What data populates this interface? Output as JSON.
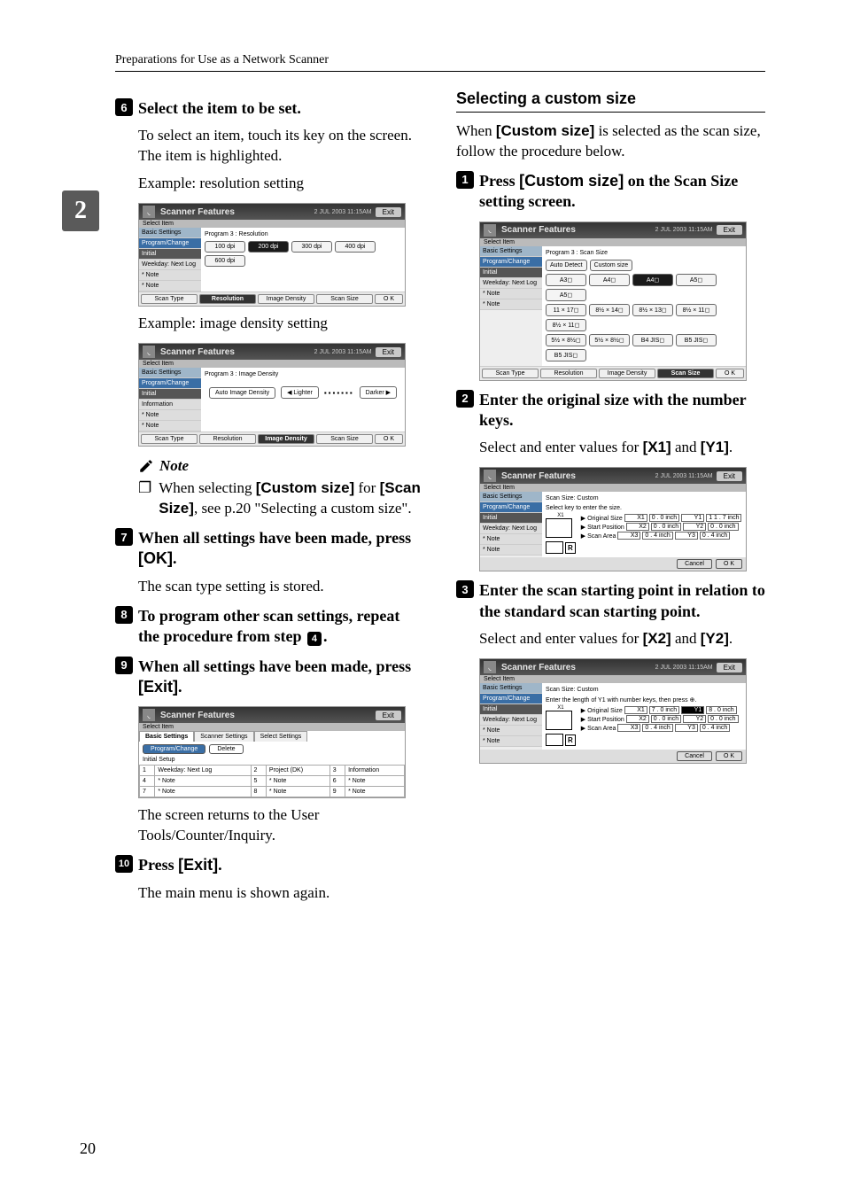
{
  "page": {
    "header": "Preparations for Use as a Network Scanner",
    "number": "20",
    "side_tab": "2"
  },
  "left": {
    "step6": {
      "badge": "6",
      "title": "Select the item to be set.",
      "p1": "To select an item, touch its key on the screen. The item is highlighted.",
      "p2": "Example: resolution setting",
      "p3": "Example: image density setting"
    },
    "note": {
      "heading": "Note",
      "item1_a": "When selecting ",
      "item1_b": "[Custom size]",
      "item1_c": " for ",
      "item1_d": "[Scan Size]",
      "item1_e": ", see p.20 \"Selecting a custom size\"."
    },
    "step7": {
      "badge": "7",
      "t1": "When all settings have been made, press ",
      "t2": "[OK]",
      "t3": ".",
      "p1": "The scan type setting is stored."
    },
    "step8": {
      "badge": "8",
      "t1": "To program other scan settings, repeat the procedure from step ",
      "t2": "4",
      "t3": "."
    },
    "step9": {
      "badge": "9",
      "t1": "When all settings have been made, press ",
      "t2": "[Exit]",
      "t3": ".",
      "p1": "The screen returns to the User Tools/Counter/Inquiry."
    },
    "step10": {
      "badge": "10",
      "t1": "Press ",
      "t2": "[Exit]",
      "t3": ".",
      "p1": "The main menu is shown again."
    }
  },
  "right": {
    "subhead": "Selecting a custom size",
    "intro_a": "When ",
    "intro_b": "[Custom size]",
    "intro_c": " is selected as the scan size, follow the procedure below.",
    "step1": {
      "badge": "1",
      "t1": "Press ",
      "t2": "[Custom size]",
      "t3": " on the Scan Size setting screen."
    },
    "step2": {
      "badge": "2",
      "t1": "Enter the original size with the number keys.",
      "p1_a": "Select and enter values for ",
      "p1_b": "[X1]",
      "p1_c": " and ",
      "p1_d": "[Y1]",
      "p1_e": "."
    },
    "step3": {
      "badge": "3",
      "t1": "Enter the scan starting point in relation to the standard scan starting point.",
      "p1_a": "Select and enter values for ",
      "p1_b": "[X2]",
      "p1_c": " and ",
      "p1_d": "[Y2]",
      "p1_e": "."
    }
  },
  "shots": {
    "common": {
      "title": "Scanner Features",
      "exit": "Exit",
      "date": "2 JUL 2003 11:15AM",
      "select_item": "Select Item",
      "side_basic": "Basic Settings",
      "side_prog": "Program/Change",
      "side_initial": "Initial",
      "side_week": "Weekday: Next Log",
      "side_info": "Information",
      "side_note": "* Note",
      "tabs": {
        "scan_type": "Scan Type",
        "resolution": "Resolution",
        "image_density": "Image Density",
        "scan_size": "Scan Size",
        "ok": "O K"
      }
    },
    "resolution": {
      "crumb": "Program 3 : Resolution",
      "opts": [
        "100 dpi",
        "200 dpi",
        "300 dpi",
        "400 dpi",
        "600 dpi"
      ],
      "sel": "200 dpi"
    },
    "density": {
      "crumb": "Program 3 : Image Density",
      "auto": "Auto Image Density",
      "lighter": "◀ Lighter",
      "darker": "Darker ▶"
    },
    "exitlist": {
      "tabs": [
        "Basic Settings",
        "Scanner Settings",
        "Select Settings"
      ],
      "btns": [
        "Program/Change",
        "Delete"
      ],
      "initial": "Initial Setup",
      "rows": [
        [
          "1",
          "Weekday: Next Log",
          "2",
          "Project (DK)",
          "3",
          "Information"
        ],
        [
          "4",
          "* Note",
          "5",
          "* Note",
          "6",
          "* Note"
        ],
        [
          "7",
          "* Note",
          "8",
          "* Note",
          "9",
          "* Note"
        ]
      ]
    },
    "scansize": {
      "crumb": "Program 3 : Scan Size",
      "auto": "Auto Detect",
      "custom": "Custom size",
      "row1": [
        "A3◻",
        "A4◻",
        "A4◻",
        "A5◻",
        "A5◻"
      ],
      "row2": [
        "11 × 17◻",
        "8½ × 14◻",
        "8½ × 13◻",
        "8½ × 11◻",
        "8½ × 11◻"
      ],
      "row3": [
        "5½ × 8½◻",
        "5½ × 8½◻",
        "B4 JIS◻",
        "B5 JIS◻",
        "B5 JIS◻"
      ]
    },
    "custom1": {
      "crumb": "Scan Size: Custom",
      "hint": "Select key to enter the size.",
      "labels": {
        "orig": "▶ Original Size",
        "start": "▶ Start Position",
        "area": "▶ Scan Area",
        "r": "R",
        "x1": "X1",
        "x2": "X2",
        "x3": "X3",
        "y1": "Y1",
        "y2": "Y2",
        "y3": "Y3"
      },
      "vals": {
        "x1": "0 .  0 inch",
        "y1": "1 1 .  7 inch",
        "x2": "0 .  0 inch",
        "y2": "0 .  0 inch",
        "x3": "0 .  4 inch",
        "y3": "0 .  4 inch"
      },
      "cancel": "Cancel",
      "ok": "O K"
    },
    "custom2": {
      "crumb": "Scan Size: Custom",
      "hint": "Enter the length of Y1 with number keys, then press ⊕.",
      "vals": {
        "x1": "7 .  0 inch",
        "y1": "8 .  0 inch",
        "x2": "0 .  0 inch",
        "y2": "0 .  0 inch",
        "x3": "0 .  4 inch",
        "y3": "0 .  4 inch"
      }
    }
  }
}
